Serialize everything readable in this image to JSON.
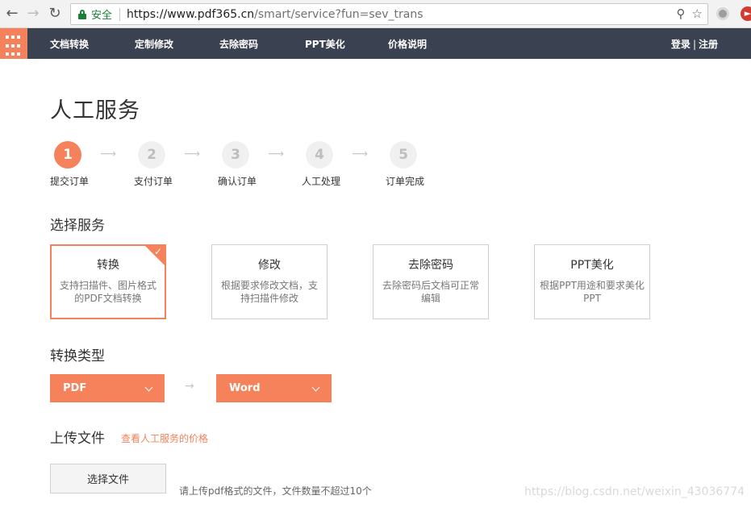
{
  "browser": {
    "secure_label": "安全",
    "url_host": "https://www.pdf365.cn",
    "url_path": "/smart/service?fun=sev_trans"
  },
  "nav": {
    "items": [
      "文档转换",
      "定制修改",
      "去除密码",
      "PPT美化",
      "价格说明"
    ],
    "login": "登录",
    "separator": "|",
    "register": "注册"
  },
  "page": {
    "title": "人工服务"
  },
  "steps": [
    {
      "number": "1",
      "label": "提交订单",
      "active": true
    },
    {
      "number": "2",
      "label": "支付订单",
      "active": false
    },
    {
      "number": "3",
      "label": "确认订单",
      "active": false
    },
    {
      "number": "4",
      "label": "人工处理",
      "active": false
    },
    {
      "number": "5",
      "label": "订单完成",
      "active": false
    }
  ],
  "services": {
    "title": "选择服务",
    "cards": [
      {
        "name": "转换",
        "desc": "支持扫描件、图片格式的PDF文档转换",
        "selected": true
      },
      {
        "name": "修改",
        "desc": "根据要求修改文档，支持扫描件修改",
        "selected": false
      },
      {
        "name": "去除密码",
        "desc": "去除密码后文档可正常编辑",
        "selected": false
      },
      {
        "name": "PPT美化",
        "desc": "根据PPT用途和要求美化PPT",
        "selected": false
      }
    ]
  },
  "conversion": {
    "title": "转换类型",
    "from": "PDF",
    "to": "Word",
    "arrow": "→"
  },
  "upload": {
    "title": "上传文件",
    "price_link": "查看人工服务的价格",
    "choose_button": "选择文件",
    "hint": "请上传pdf格式的文件，文件数量不超过10个"
  },
  "watermark": "https://blog.csdn.net/weixin_43036774",
  "colors": {
    "accent": "#f5825a",
    "nav_bg": "#3a4150",
    "secure_green": "#188038"
  }
}
